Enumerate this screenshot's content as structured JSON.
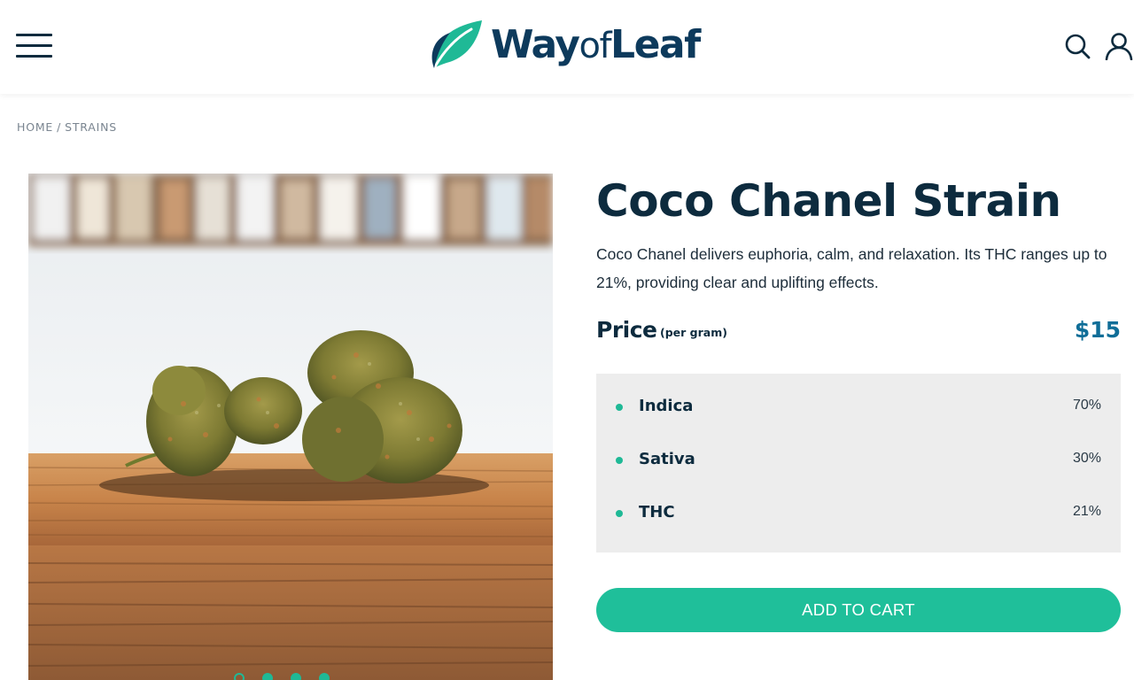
{
  "header": {
    "logo_text_way": "Way",
    "logo_text_of": "of",
    "logo_text_leaf": "Leaf",
    "icons": [
      "menu-icon",
      "leaf-logo-icon",
      "search-icon",
      "user-icon"
    ]
  },
  "breadcrumb": {
    "home": "HOME",
    "separator": "/",
    "current": "STRAINS"
  },
  "product": {
    "title": "Coco Chanel Strain",
    "description": "Coco Chanel delivers euphoria, calm, and relaxation. Its THC ranges up to 21%, providing clear and uplifting effects.",
    "price_label": "Price",
    "price_unit": "(per gram)",
    "price_value": "$15",
    "stats": [
      {
        "label": "Indica",
        "value": "70%"
      },
      {
        "label": "Sativa",
        "value": "30%"
      },
      {
        "label": "THC",
        "value": "21%"
      }
    ],
    "cta": "ADD TO CART"
  },
  "gallery": {
    "slide_count": 4,
    "active_slide": 1
  },
  "colors": {
    "brand_navy": "#0d3a5c",
    "accent_teal": "#1fbf9a",
    "price_blue": "#106e98",
    "stats_bg": "#ededed"
  }
}
